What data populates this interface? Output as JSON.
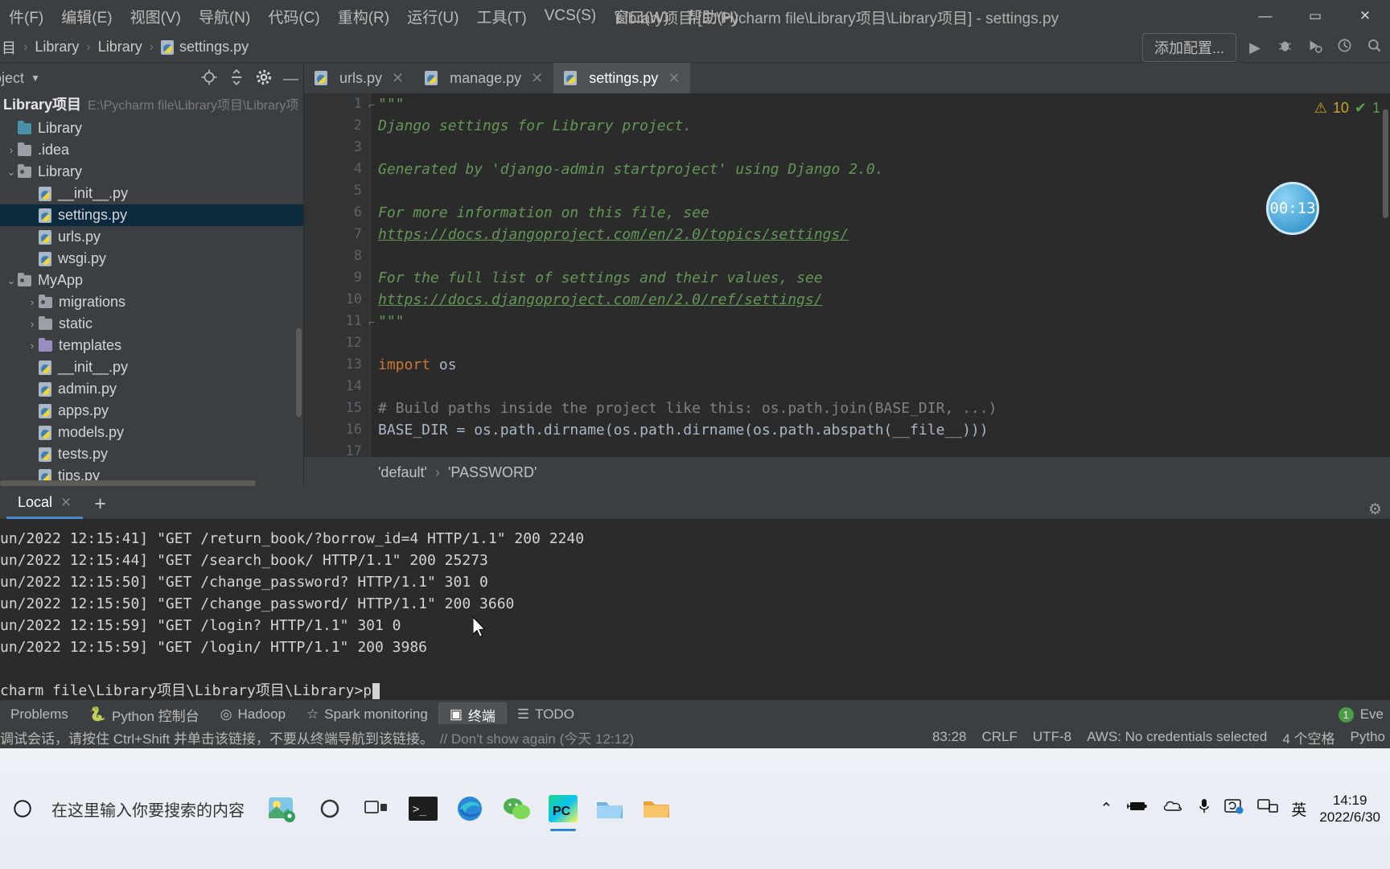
{
  "window": {
    "title": "Library项目 [E:\\Pycharm file\\Library项目\\Library项目] - settings.py",
    "minimize": "—",
    "maximize": "▭",
    "close": "✕"
  },
  "menubar": {
    "items": [
      {
        "label": "件(F)",
        "mnemonic": "F"
      },
      {
        "label": "编辑(E)",
        "mnemonic": "E"
      },
      {
        "label": "视图(V)",
        "mnemonic": "V"
      },
      {
        "label": "导航(N)",
        "mnemonic": "N"
      },
      {
        "label": "代码(C)",
        "mnemonic": "C"
      },
      {
        "label": "重构(R)",
        "mnemonic": "R"
      },
      {
        "label": "运行(U)",
        "mnemonic": "U"
      },
      {
        "label": "工具(T)",
        "mnemonic": "T"
      },
      {
        "label": "VCS(S)",
        "mnemonic": "S"
      },
      {
        "label": "窗口(W)",
        "mnemonic": "W"
      },
      {
        "label": "帮助(H)",
        "mnemonic": "H"
      }
    ]
  },
  "navbar": {
    "crumbs": [
      "目",
      "Library",
      "Library",
      "settings.py"
    ],
    "separator": "›",
    "add_configuration": "添加配置...",
    "run_icon": "▶",
    "debug_icon": "🐞",
    "coverage_icon": "▶",
    "profile_icon": "◔",
    "search_icon": "⌕"
  },
  "project_panel": {
    "header": "oject",
    "caret": "▼",
    "tools": [
      "locate-icon",
      "collapse-icon",
      "gear-icon",
      "hide-icon"
    ],
    "root_name": "Library项目",
    "root_path": "E:\\Pycharm file\\Library项目\\Library项",
    "tree": [
      {
        "label": "Library",
        "depth": 0,
        "arrow": "",
        "kind": "folder-blue"
      },
      {
        "label": ".idea",
        "depth": 0,
        "arrow": "›",
        "kind": "folder-gray"
      },
      {
        "label": "Library",
        "depth": 0,
        "arrow": "⌄",
        "kind": "folder-src"
      },
      {
        "label": "__init__.py",
        "depth": 1,
        "arrow": "",
        "kind": "py"
      },
      {
        "label": "settings.py",
        "depth": 1,
        "arrow": "",
        "kind": "py",
        "selected": true
      },
      {
        "label": "urls.py",
        "depth": 1,
        "arrow": "",
        "kind": "py"
      },
      {
        "label": "wsgi.py",
        "depth": 1,
        "arrow": "",
        "kind": "py"
      },
      {
        "label": "MyApp",
        "depth": 0,
        "arrow": "⌄",
        "kind": "folder-src"
      },
      {
        "label": "migrations",
        "depth": 1,
        "arrow": "›",
        "kind": "folder-src"
      },
      {
        "label": "static",
        "depth": 1,
        "arrow": "›",
        "kind": "folder-gray"
      },
      {
        "label": "templates",
        "depth": 1,
        "arrow": "›",
        "kind": "folder-purple"
      },
      {
        "label": "__init__.py",
        "depth": 1,
        "arrow": "",
        "kind": "py"
      },
      {
        "label": "admin.py",
        "depth": 1,
        "arrow": "",
        "kind": "py"
      },
      {
        "label": "apps.py",
        "depth": 1,
        "arrow": "",
        "kind": "py"
      },
      {
        "label": "models.py",
        "depth": 1,
        "arrow": "",
        "kind": "py"
      },
      {
        "label": "tests.py",
        "depth": 1,
        "arrow": "",
        "kind": "py"
      },
      {
        "label": "tips.py",
        "depth": 1,
        "arrow": "",
        "kind": "py"
      }
    ]
  },
  "editor": {
    "tabs": [
      {
        "label": "urls.py",
        "active": false,
        "closable": true
      },
      {
        "label": "manage.py",
        "active": false,
        "closable": true
      },
      {
        "label": "settings.py",
        "active": true,
        "closable": true
      }
    ],
    "inspection": {
      "warning_count": "10",
      "warn_icon": "⚠",
      "ok_icon": "✔",
      "ok_count": "1"
    },
    "timer_badge": "00:13",
    "lines": [
      {
        "n": "1",
        "fold": "⌐",
        "segs": [
          {
            "t": "\"\"\"",
            "c": "doc"
          }
        ]
      },
      {
        "n": "2",
        "segs": [
          {
            "t": "Django settings for Library project.",
            "c": "doc"
          }
        ]
      },
      {
        "n": "3",
        "segs": [
          {
            "t": "",
            "c": "doc"
          }
        ]
      },
      {
        "n": "4",
        "segs": [
          {
            "t": "Generated by 'django-admin startproject' using Django 2.0.",
            "c": "doc"
          }
        ]
      },
      {
        "n": "5",
        "segs": [
          {
            "t": "",
            "c": "doc"
          }
        ]
      },
      {
        "n": "6",
        "segs": [
          {
            "t": "For more information on this file, see",
            "c": "doc"
          }
        ]
      },
      {
        "n": "7",
        "segs": [
          {
            "t": "https://docs.djangoproject.com/en/2.0/topics/settings/",
            "c": "link"
          }
        ]
      },
      {
        "n": "8",
        "segs": [
          {
            "t": "",
            "c": "doc"
          }
        ]
      },
      {
        "n": "9",
        "segs": [
          {
            "t": "For the full list of settings and their values, see",
            "c": "doc"
          }
        ]
      },
      {
        "n": "10",
        "segs": [
          {
            "t": "https://docs.djangoproject.com/en/2.0/ref/settings/",
            "c": "link"
          }
        ]
      },
      {
        "n": "11",
        "fold": "⌐",
        "segs": [
          {
            "t": "\"\"\"",
            "c": "doc"
          }
        ]
      },
      {
        "n": "12",
        "segs": [
          {
            "t": "",
            "c": "plain"
          }
        ]
      },
      {
        "n": "13",
        "segs": [
          {
            "t": "import",
            "c": "kw"
          },
          {
            "t": " os",
            "c": "plain"
          }
        ]
      },
      {
        "n": "14",
        "segs": [
          {
            "t": "",
            "c": "plain"
          }
        ]
      },
      {
        "n": "15",
        "segs": [
          {
            "t": "# Build paths inside the project like this: os.path.join(BASE_DIR, ...)",
            "c": "cmt"
          }
        ]
      },
      {
        "n": "16",
        "segs": [
          {
            "t": "BASE_DIR = os.path.dirname(os.path.dirname(os.path.abspath(__file__)))",
            "c": "plain"
          }
        ]
      },
      {
        "n": "17",
        "segs": [
          {
            "t": "",
            "c": "plain"
          }
        ]
      }
    ],
    "status_breadcrumb": [
      "'default'",
      "'PASSWORD'"
    ],
    "status_separator": "›"
  },
  "terminal": {
    "tabs": [
      {
        "label": "Local",
        "active": true,
        "close": "✕"
      }
    ],
    "add_label": "+",
    "settings_icon": "⚙",
    "lines": [
      "un/2022 12:15:41] \"GET /return_book/?borrow_id=4 HTTP/1.1\" 200 2240",
      "un/2022 12:15:44] \"GET /search_book/ HTTP/1.1\" 200 25273",
      "un/2022 12:15:50] \"GET /change_password? HTTP/1.1\" 301 0",
      "un/2022 12:15:50] \"GET /change_password/ HTTP/1.1\" 200 3660",
      "un/2022 12:15:59] \"GET /login? HTTP/1.1\" 301 0",
      "un/2022 12:15:59] \"GET /login/ HTTP/1.1\" 200 3986"
    ],
    "prompt": "charm file\\Library项目\\Library项目\\Library>p"
  },
  "bottom_toolbar": {
    "items": [
      {
        "label": "Problems",
        "icon": "",
        "active": false
      },
      {
        "label": "Python 控制台",
        "icon": "python-icon",
        "active": false
      },
      {
        "label": "Hadoop",
        "icon": "hadoop-icon",
        "active": false
      },
      {
        "label": "Spark monitoring",
        "icon": "star-icon",
        "active": false
      },
      {
        "label": "终端",
        "icon": "terminal-icon",
        "active": true
      },
      {
        "label": "TODO",
        "icon": "list-icon",
        "active": false
      }
    ],
    "right_badge": "1",
    "right_label": "Eve"
  },
  "statusbar": {
    "hint": "调试会话，请按住 Ctrl+Shift 并单击该链接，不要从终端导航到该链接。",
    "hint_link": "// Don't show again (今天 12:12)",
    "caret_position": "83:28",
    "line_separator": "CRLF",
    "encoding": "UTF-8",
    "aws": "AWS: No credentials selected",
    "indent": "4 个空格",
    "interpreter": "Pytho"
  },
  "taskbar": {
    "start_icon": "⊙",
    "search_placeholder": "在这里输入你要搜索的内容",
    "apps": [
      "weather-icon",
      "cortana-icon",
      "taskview-icon",
      "terminal-icon",
      "edge-icon",
      "wechat-icon",
      "pycharm-icon",
      "explorer2-icon",
      "folder-icon"
    ],
    "tray": [
      "chevron-up-icon",
      "battery-icon",
      "onedrive-icon",
      "mic-icon",
      "sync-icon",
      "display-icon"
    ],
    "ime": "英",
    "clock_time": "14:19",
    "clock_date": "2022/6/30"
  }
}
